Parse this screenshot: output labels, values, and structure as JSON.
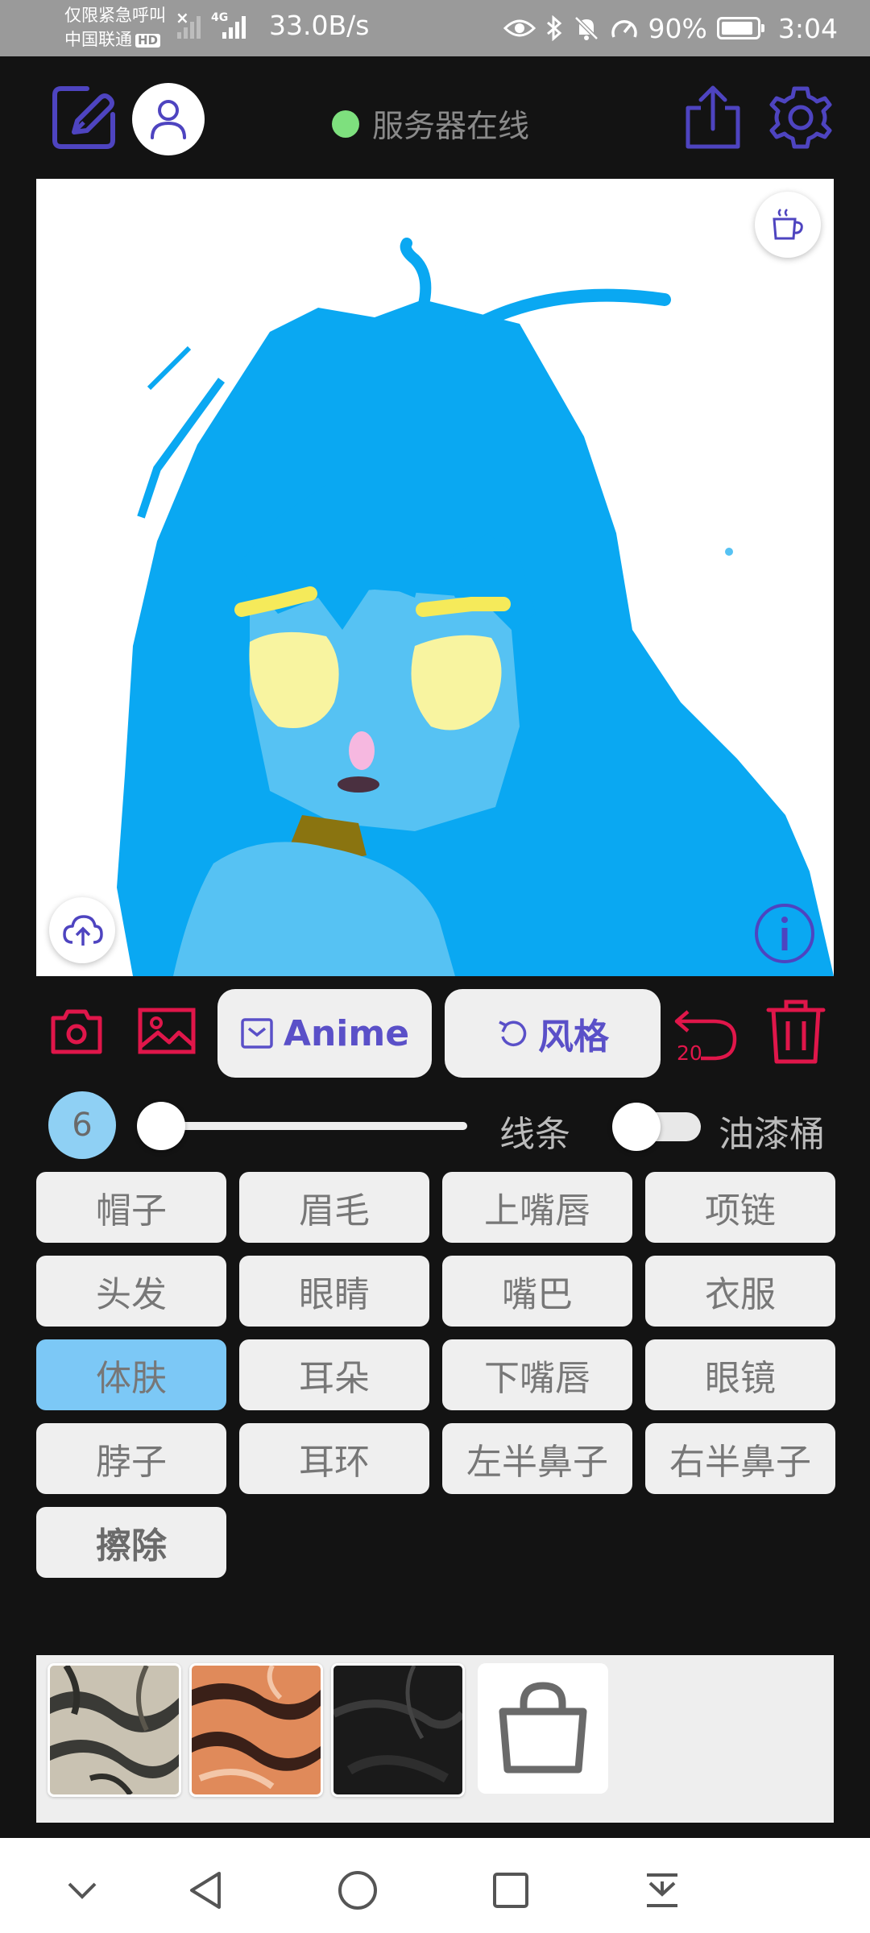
{
  "status_bar": {
    "carrier_line1": "仅限紧急呼叫",
    "carrier_line2": "中国联通",
    "hd_badge": "HD",
    "network_type": "4G",
    "net_speed": "33.0B/s",
    "battery_percent": "90%",
    "battery_level": 0.9,
    "time": "3:04"
  },
  "header": {
    "server_status": "服务器在线",
    "status_color": "#7ee07e",
    "left_icons": [
      "edit-icon",
      "user-icon"
    ],
    "right_icons": [
      "share-icon",
      "gear-icon"
    ]
  },
  "canvas": {
    "top_right_icon": "coffee-cup-icon",
    "bottom_left_icon": "cloud-upload-icon",
    "bottom_right_icon": "info-icon"
  },
  "toolbar": {
    "camera_icon": "camera-icon",
    "gallery_icon": "image-icon",
    "anime_label": "Anime",
    "style_label": "风格",
    "undo_count": "20",
    "delete_icon": "trash-icon",
    "accent_color": "#e0164a",
    "primary_color": "#5a50c8"
  },
  "brush": {
    "size": "6",
    "slider_fraction": 0.0,
    "lines_label": "线条",
    "paint_bucket_label": "油漆桶",
    "paint_bucket_on": false
  },
  "parts": [
    {
      "label": "帽子",
      "active": false
    },
    {
      "label": "眉毛",
      "active": false
    },
    {
      "label": "上嘴唇",
      "active": false
    },
    {
      "label": "项链",
      "active": false
    },
    {
      "label": "头发",
      "active": false
    },
    {
      "label": "眼睛",
      "active": false
    },
    {
      "label": "嘴巴",
      "active": false
    },
    {
      "label": "衣服",
      "active": false
    },
    {
      "label": "体肤",
      "active": true
    },
    {
      "label": "耳朵",
      "active": false
    },
    {
      "label": "下嘴唇",
      "active": false
    },
    {
      "label": "眼镜",
      "active": false
    },
    {
      "label": "脖子",
      "active": false
    },
    {
      "label": "耳环",
      "active": false
    },
    {
      "label": "左半鼻子",
      "active": false
    },
    {
      "label": "右半鼻子",
      "active": false
    },
    {
      "label": "擦除",
      "active": false
    }
  ],
  "textures": [
    "texture-zebra-silver",
    "texture-tiger-orange",
    "texture-dark-black"
  ],
  "shop_icon": "shopping-bag-icon",
  "nav": [
    "chevron-down-icon",
    "back-icon",
    "home-icon",
    "recents-icon",
    "notification-pull-icon"
  ]
}
